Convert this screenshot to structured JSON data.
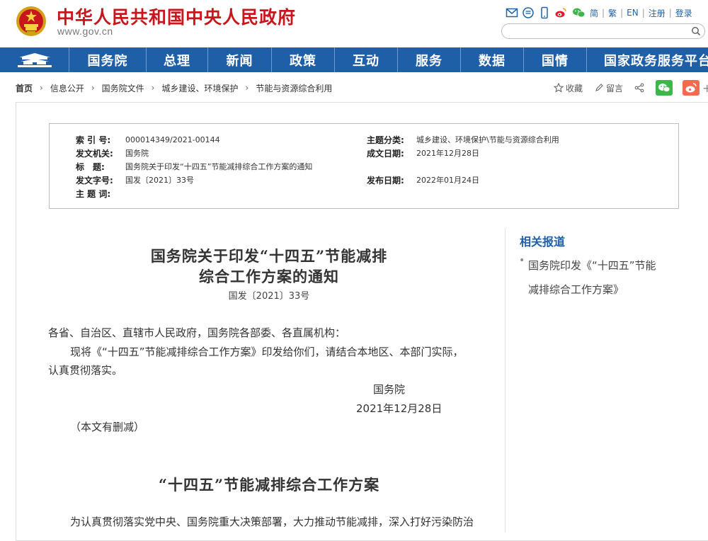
{
  "header": {
    "site_title": "中华人民共和国中央人民政府",
    "site_url": "www.gov.cn",
    "top_links": [
      "简",
      "繁",
      "EN",
      "注册",
      "登录"
    ],
    "search_placeholder": ""
  },
  "nav": {
    "items": [
      "国务院",
      "总理",
      "新闻",
      "政策",
      "互动",
      "服务",
      "数据",
      "国情",
      "国家政务服务平台"
    ]
  },
  "breadcrumb": {
    "items": [
      "首页",
      "信息公开",
      "国务院文件",
      "城乡建设、环境保护",
      "节能与资源综合利用"
    ]
  },
  "tools": {
    "favorite": "收藏",
    "comment": "留言",
    "more": "+"
  },
  "meta": {
    "index_label": "索 引 号:",
    "index_value": "000014349/2021-00144",
    "topic_label": "主题分类:",
    "topic_value": "城乡建设、环境保护\\节能与资源综合利用",
    "issuer_label": "发文机关:",
    "issuer_value": "国务院",
    "date_written_label": "成文日期:",
    "date_written_value": "2021年12月28日",
    "title_label": "标　题:",
    "title_value": "国务院关于印发“十四五”节能减排综合工作方案的通知",
    "doc_no_label": "发文字号:",
    "doc_no_value": "国发〔2021〕33号",
    "publish_label": "发布日期:",
    "publish_value": "2022年01月24日",
    "keywords_label": "主 题 词:"
  },
  "article": {
    "title_line1": "国务院关于印发“十四五”节能减排",
    "title_line2": "综合工作方案的通知",
    "doc_no": "国发〔2021〕33号",
    "salutation": "各省、自治区、直辖市人民政府，国务院各部委、各直属机构：",
    "body_line1": "现将《“十四五”节能减排综合工作方案》印发给你们，请结合本地区、本部门实际，",
    "body_line2": "认真贯彻落实。",
    "signer": "国务院",
    "sign_date": "2021年12月28日",
    "note": "（本文有删减）",
    "plan_title": "“十四五”节能减排综合工作方案",
    "plan_para": "为认真贯彻落实党中央、国务院重大决策部署，大力推动节能减排，深入打好污染防治"
  },
  "sidebar": {
    "title": "相关报道",
    "related_line1": "国务院印发《“十四五”节能",
    "related_line2": "减排综合工作方案》"
  },
  "colors": {
    "brand_red": "#c8161d",
    "nav_blue": "#1f5fa7",
    "wechat_green": "#3db64a",
    "weibo_orange": "#f26b4f"
  }
}
